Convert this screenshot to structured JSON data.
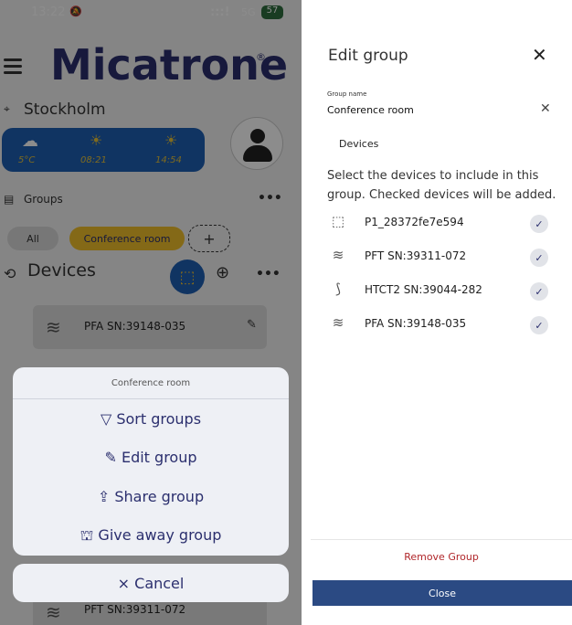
{
  "left": {
    "status": {
      "time": "13:22",
      "silent_icon": "bell-off-icon",
      "network": "5G",
      "battery": "57",
      "signal": ":::!"
    },
    "brand": "Micatrone",
    "brand_reg": "®",
    "location": "Stockholm",
    "weather": {
      "temp": "5°C",
      "sunrise": "08:21",
      "sunset": "14:54"
    },
    "groups_label": "Groups",
    "more": "•••",
    "chips": {
      "all": "All",
      "conference": "Conference room",
      "add": "+"
    },
    "devices_label": "Devices",
    "device_rows": [
      "PFA SN:39148-035",
      "PFT SN:39311-072"
    ],
    "sheet": {
      "title": "Conference room",
      "items": [
        "Sort groups",
        "Edit group",
        "Share group",
        "Give away group"
      ],
      "icons": {
        "sort": "▽",
        "edit": "✎",
        "share": "⇪",
        "give": "⛫"
      },
      "cancel": "Cancel",
      "cancel_icon": "×"
    }
  },
  "right": {
    "title": "Edit group",
    "close_icon": "✕",
    "group_name_label": "Group name",
    "group_name_value": "Conference room",
    "clear_icon": "✕",
    "devices_label": "Devices",
    "description": "Select the devices to include in this group. Checked devices will be added.",
    "devices": [
      {
        "icon": "⬚",
        "name": "P1_28372fe7e594",
        "checked": "✓"
      },
      {
        "icon": "≋",
        "name": "PFT SN:39311-072",
        "checked": "✓"
      },
      {
        "icon": "⟆",
        "name": "HTCT2 SN:39044-282",
        "checked": "✓"
      },
      {
        "icon": "≋",
        "name": "PFA SN:39148-035",
        "checked": "✓"
      }
    ],
    "remove": "Remove Group",
    "close": "Close"
  },
  "colors": {
    "brand": "#2b2f6e",
    "accent": "#1e5fb3",
    "danger": "#b0262a"
  }
}
